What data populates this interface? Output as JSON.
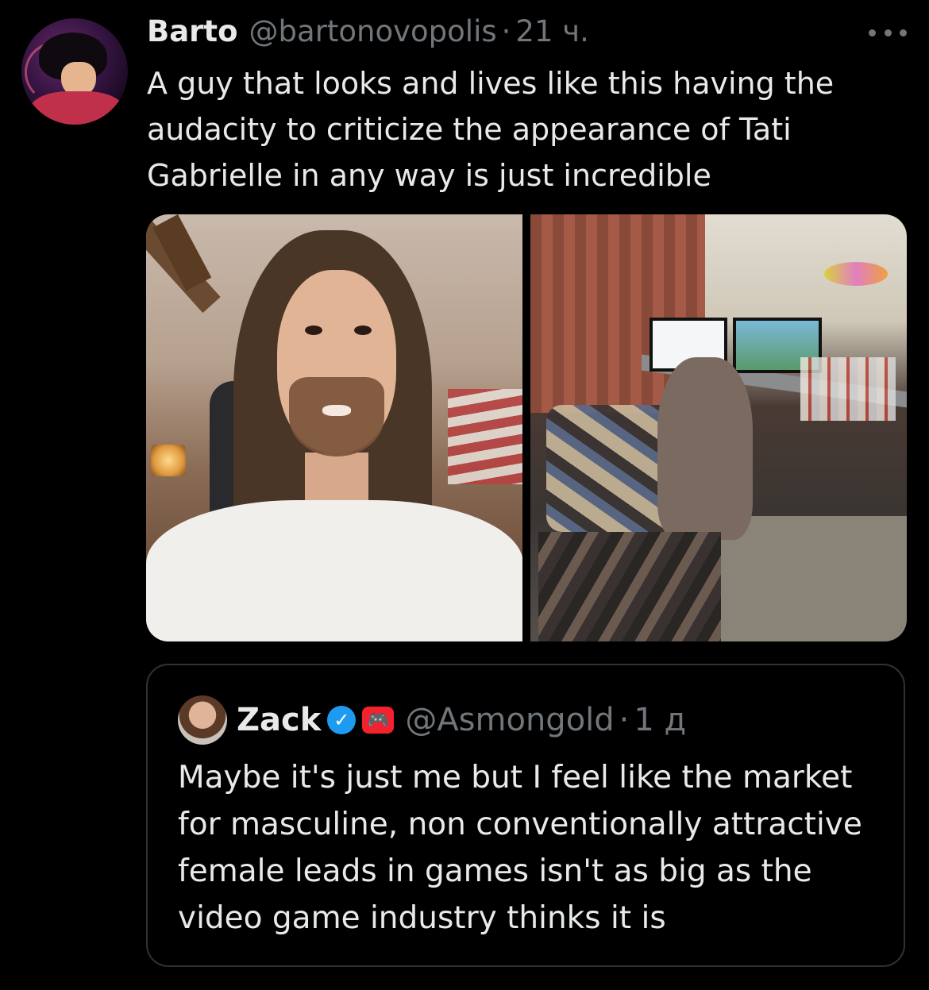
{
  "tweet": {
    "author_name": "Barto",
    "author_handle": "@bartonovopolis",
    "separator": "·",
    "time": "21 ч.",
    "avatar_icon": "anime-character-avatar",
    "more_icon": "ellipsis-icon",
    "text": "A guy that looks and lives like this having the audacity to criticize the appearance of Tati Gabrielle in any way is just incredible"
  },
  "quote": {
    "author_name": "Zack",
    "verified_icon": "✓",
    "affiliate_icon": "🎮",
    "author_handle": "@Asmongold",
    "separator": "·",
    "time": "1 д",
    "text": "Maybe it's just me but I feel like the market for masculine, non conventionally attractive female leads in games isn't as big as the video game industry thinks it is"
  },
  "colors": {
    "background": "#000000",
    "text": "#e7e9ea",
    "secondary": "#71767b",
    "border": "#2f3336",
    "verified": "#1d9bf0",
    "affiliate_badge": "#f4212e"
  }
}
